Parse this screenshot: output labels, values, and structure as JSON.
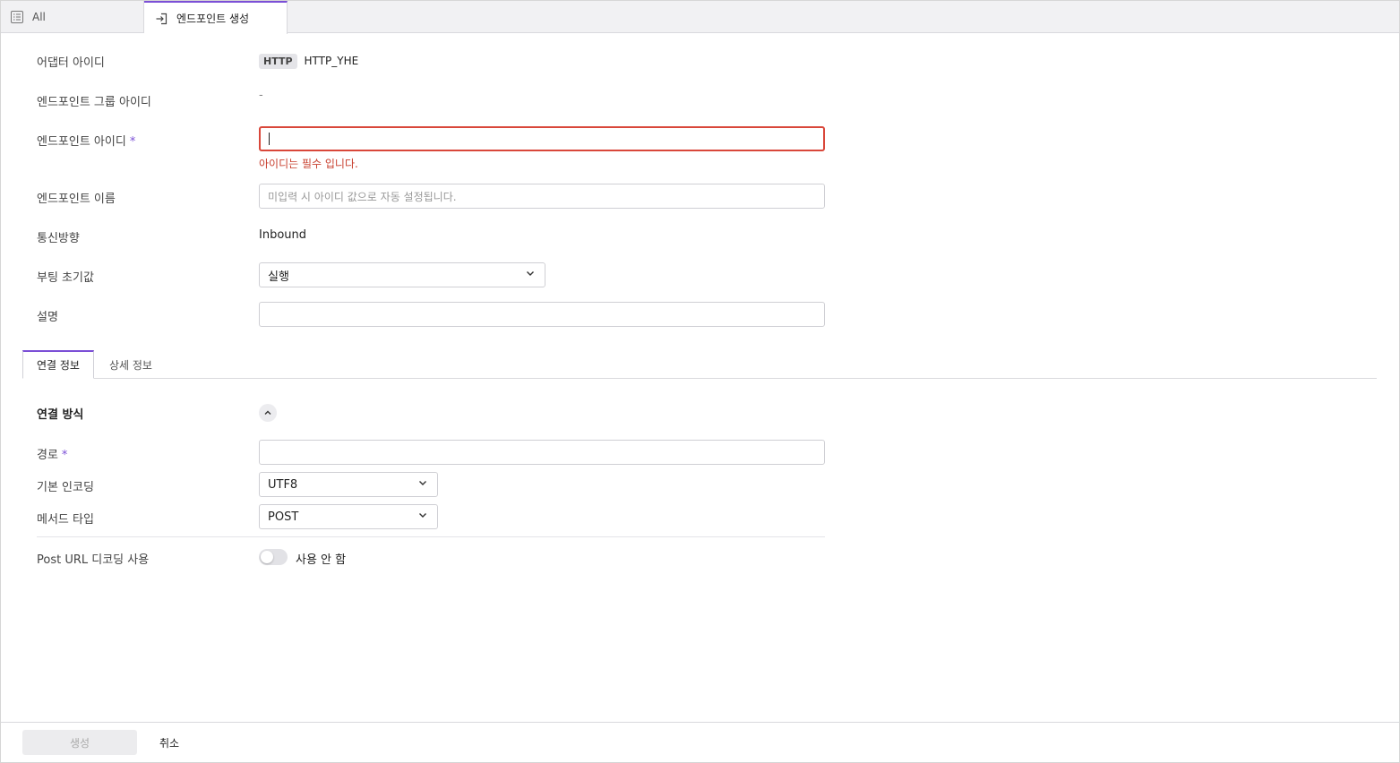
{
  "tabs": {
    "all_label": "All",
    "active_label": "엔드포인트 생성"
  },
  "form": {
    "adapter_id": {
      "label": "어댑터 아이디",
      "badge": "HTTP",
      "value": "HTTP_YHE"
    },
    "endpoint_group_id": {
      "label": "엔드포인트 그룹 아이디",
      "value": "-"
    },
    "endpoint_id": {
      "label": "엔드포인트 아이디",
      "required_mark": "*",
      "value": "",
      "error": "아이디는 필수 입니다."
    },
    "endpoint_name": {
      "label": "엔드포인트 이름",
      "placeholder": "미입력 시 아이디 값으로 자동 설정됩니다."
    },
    "direction": {
      "label": "통신방향",
      "value": "Inbound"
    },
    "boot_default": {
      "label": "부팅 초기값",
      "value": "실행"
    },
    "description": {
      "label": "설명",
      "value": ""
    }
  },
  "subtabs": {
    "connection_label": "연결 정보",
    "detail_label": "상세 정보"
  },
  "connection": {
    "section_title": "연결 방식",
    "path": {
      "label": "경로",
      "required_mark": "*",
      "value": ""
    },
    "encoding": {
      "label": "기본 인코딩",
      "value": "UTF8"
    },
    "method": {
      "label": "메서드 타입",
      "value": "POST"
    },
    "post_url_decoding": {
      "label": "Post URL 디코딩 사용",
      "state_text": "사용 안 함",
      "enabled": false
    }
  },
  "footer": {
    "create_label": "생성",
    "cancel_label": "취소"
  },
  "colors": {
    "accent": "#7b4fd6",
    "error": "#d9473a"
  }
}
